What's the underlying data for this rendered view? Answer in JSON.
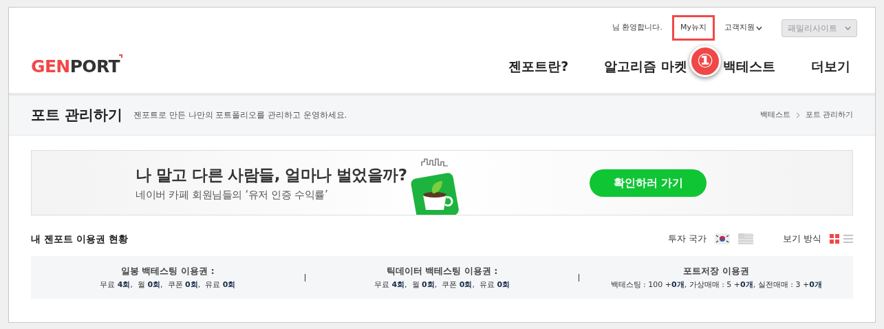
{
  "top_bar": {
    "greeting": "님 환영합니다.",
    "links": [
      {
        "label": "My뉴지",
        "annotated": true,
        "dropdown": false
      },
      {
        "label": "고객지원",
        "annotated": false,
        "dropdown": true
      }
    ],
    "family_select": {
      "placeholder": "패밀리사이트"
    }
  },
  "annotation": {
    "marker": "①"
  },
  "logo": {
    "accent": "GEN",
    "rest": "PORT"
  },
  "nav": [
    "젠포트란?",
    "알고리즘 마켓",
    "백테스트",
    "더보기"
  ],
  "page_header": {
    "title": "포트 관리하기",
    "description": "젠포트로 만든 나만의 포트폴리오를 관리하고 운영하세요.",
    "breadcrumb": [
      "백테스트",
      "포트 관리하기"
    ]
  },
  "banner": {
    "headline": "나 말고 다른 사람들, 얼마나 벌었을까?",
    "subline": "네이버 카페 회원님들의 ‘유저 인증 수익률’",
    "button": "확인하러 가기"
  },
  "section": {
    "title": "내 젠포트 이용권 현황",
    "country_label": "투자 국가",
    "countries": [
      {
        "kind": "kr"
      },
      {
        "kind": "us"
      }
    ],
    "view_label": "보기 방식",
    "views": [
      {
        "kind": "grid",
        "selected": true
      },
      {
        "kind": "list",
        "selected": false
      }
    ]
  },
  "passes": [
    {
      "title": "일봉 백테스팅 이용권 :",
      "detail": "무료 **4회**,  월 **0회**,  쿠폰 **0회**,  유료 **0회**"
    },
    {
      "title": "틱데이터 백테스팅 이용권 :",
      "detail": "무료 **4회**,  월 **0회**,  쿠폰 **0회**,  유료 **0회**"
    },
    {
      "title": "포트저장 이용권",
      "detail": "백테스팅 : 100 +**0개**, 가상매매 : 5 +**0개**, 실전매매 : 3 +**0개**"
    }
  ]
}
